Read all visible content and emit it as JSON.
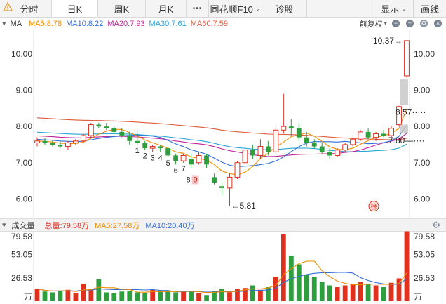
{
  "tabs": [
    {
      "label": "分时",
      "width": 0
    },
    {
      "label": "日K",
      "active": true
    },
    {
      "label": "周K"
    },
    {
      "label": "月K"
    },
    {
      "label": "•••"
    },
    {
      "label": "同花顺F10",
      "dropdown": true
    },
    {
      "label": "诊股"
    }
  ],
  "right_tabs": {
    "display": "显示",
    "draw": "画线"
  },
  "ma_legend": {
    "collapse": "▾",
    "title": "MA",
    "ma5": "MA5:8.78",
    "ma10": "MA10:8.22",
    "ma20": "MA20:7.93",
    "ma30": "MA30:7.61",
    "ma60": "MA60:7.59",
    "adjust": "前复权",
    "colors": {
      "ma5": "#f08c00",
      "ma10": "#2f6fd6",
      "ma20": "#c0249a",
      "ma30": "#2aa6d6",
      "ma60": "#e05a3a"
    }
  },
  "price_axis": [
    "10.00",
    "9.00",
    "8.00",
    "7.00",
    "6.00"
  ],
  "annotations": {
    "high": "10.37",
    "low": "5.81",
    "upper_level": "8.57",
    "lower_level": "7.80",
    "seq_labels": [
      "1",
      "2",
      "3",
      "4",
      "5",
      "6",
      "7",
      "8",
      "9"
    ],
    "badge": "榜"
  },
  "volume_legend": {
    "title": "成交量",
    "total": "总量:79.58万",
    "ma5": "MA5:27.58万",
    "ma10": "MA10:20.40万",
    "colors": {
      "total": "#e0301e",
      "ma5": "#f08c00",
      "ma10": "#2f6fd6"
    }
  },
  "volume_axis": [
    "79.58",
    "53.05",
    "26.53",
    "万"
  ],
  "chart_data": {
    "type": "candlestick",
    "ylim": [
      5.6,
      10.6
    ],
    "candles": [
      [
        7.55,
        7.7,
        7.45,
        7.6
      ],
      [
        7.6,
        7.68,
        7.5,
        7.55
      ],
      [
        7.55,
        7.62,
        7.45,
        7.5
      ],
      [
        7.5,
        7.6,
        7.4,
        7.45
      ],
      [
        7.45,
        7.6,
        7.35,
        7.55
      ],
      [
        7.55,
        7.65,
        7.5,
        7.6
      ],
      [
        7.6,
        7.8,
        7.55,
        7.75
      ],
      [
        7.75,
        8.1,
        7.7,
        8.05
      ],
      [
        8.05,
        8.1,
        7.95,
        8.0
      ],
      [
        8.0,
        8.1,
        7.9,
        7.95
      ],
      [
        7.95,
        8.0,
        7.8,
        7.85
      ],
      [
        7.85,
        7.95,
        7.7,
        7.75
      ],
      [
        7.75,
        7.85,
        7.5,
        7.6
      ],
      [
        7.6,
        7.9,
        7.5,
        7.55
      ],
      [
        7.55,
        7.6,
        7.35,
        7.4
      ],
      [
        7.4,
        7.5,
        7.3,
        7.45
      ],
      [
        7.45,
        7.5,
        7.3,
        7.4
      ],
      [
        7.4,
        7.45,
        7.15,
        7.2
      ],
      [
        7.2,
        7.25,
        6.95,
        7.05
      ],
      [
        7.05,
        7.25,
        7.0,
        7.2
      ],
      [
        7.1,
        7.25,
        6.85,
        6.95
      ],
      [
        7.0,
        7.3,
        6.95,
        7.2
      ],
      [
        7.2,
        7.25,
        6.85,
        6.95
      ],
      [
        6.6,
        6.7,
        6.4,
        6.45
      ],
      [
        6.35,
        6.45,
        6.1,
        6.3
      ],
      [
        6.3,
        6.7,
        5.81,
        6.6
      ],
      [
        6.6,
        7.05,
        6.55,
        7.0
      ],
      [
        7.0,
        7.4,
        6.95,
        7.35
      ],
      [
        7.35,
        7.5,
        7.1,
        7.2
      ],
      [
        7.2,
        7.65,
        7.1,
        7.45
      ],
      [
        7.45,
        7.6,
        7.2,
        7.3
      ],
      [
        7.3,
        8.0,
        7.25,
        7.9
      ],
      [
        7.9,
        8.9,
        7.8,
        8.0
      ],
      [
        8.0,
        8.2,
        7.75,
        7.95
      ],
      [
        7.95,
        8.1,
        7.6,
        7.7
      ],
      [
        7.7,
        7.85,
        7.45,
        7.55
      ],
      [
        7.55,
        7.65,
        7.4,
        7.45
      ],
      [
        7.45,
        7.55,
        7.25,
        7.3
      ],
      [
        7.3,
        7.4,
        7.1,
        7.2
      ],
      [
        7.2,
        7.4,
        7.15,
        7.35
      ],
      [
        7.35,
        7.55,
        7.3,
        7.5
      ],
      [
        7.5,
        7.7,
        7.45,
        7.65
      ],
      [
        7.65,
        7.9,
        7.6,
        7.85
      ],
      [
        7.85,
        7.95,
        7.65,
        7.7
      ],
      [
        7.7,
        7.85,
        7.6,
        7.8
      ],
      [
        7.8,
        7.9,
        7.7,
        7.75
      ],
      [
        7.75,
        8.0,
        7.7,
        7.95
      ],
      [
        8.05,
        8.57,
        8.0,
        8.55
      ],
      [
        9.4,
        10.37,
        9.35,
        10.37
      ]
    ],
    "volume": [
      14,
      11,
      10,
      12,
      13,
      9,
      20,
      13,
      25,
      10,
      9,
      11,
      12,
      10,
      9,
      13,
      11,
      12,
      10,
      11,
      12,
      9,
      7,
      12,
      14,
      10,
      14,
      15,
      18,
      13,
      16,
      28,
      76,
      52,
      42,
      30,
      28,
      22,
      18,
      16,
      18,
      20,
      22,
      20,
      18,
      16,
      21,
      26,
      79.58
    ],
    "vol_ylim": [
      0,
      80
    ]
  }
}
